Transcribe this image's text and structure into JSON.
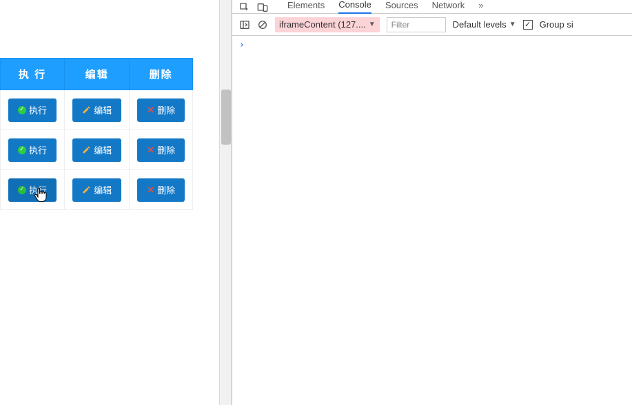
{
  "table": {
    "headers": [
      "执 行",
      "编辑",
      "删除"
    ],
    "buttons": {
      "run": "执行",
      "edit": "编辑",
      "delete": "删除"
    },
    "row_count": 3
  },
  "devtools": {
    "tabs": {
      "elements": "Elements",
      "console": "Console",
      "sources": "Sources",
      "network": "Network",
      "overflow": "»"
    },
    "active_tab": "Console",
    "toolbar": {
      "context": "iframeContent (127....",
      "filter_placeholder": "Filter",
      "levels": "Default levels",
      "group_label": "Group si"
    },
    "console": {
      "prompt": "›"
    }
  }
}
